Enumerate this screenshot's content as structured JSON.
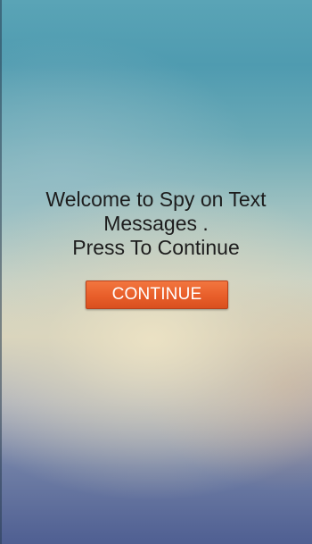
{
  "welcome": {
    "line1": "Welcome to Spy on Text",
    "line2": "Messages .",
    "line3": "Press To Continue"
  },
  "continue_button": {
    "label": "CONTINUE"
  },
  "colors": {
    "button": "#e85e2a",
    "text": "#1d1d1d",
    "button_text": "#ffffff"
  }
}
